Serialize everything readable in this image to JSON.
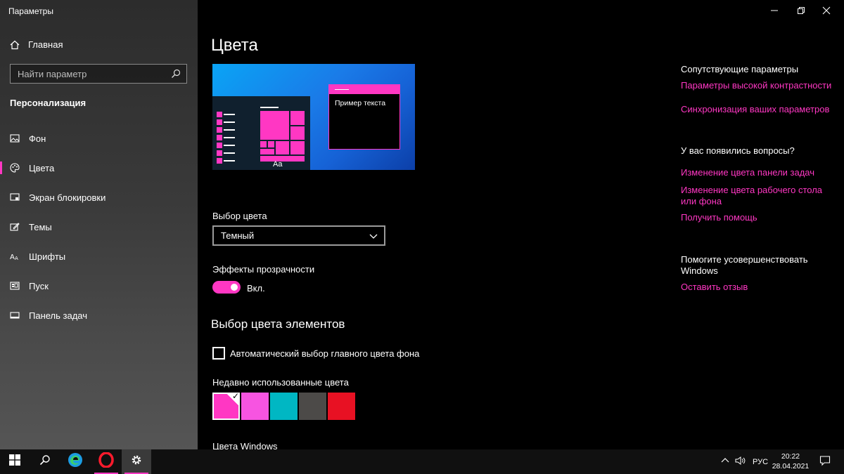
{
  "window": {
    "title": "Параметры"
  },
  "sidebar": {
    "home_label": "Главная",
    "search_placeholder": "Найти параметр",
    "section_title": "Персонализация",
    "items": [
      {
        "label": "Фон",
        "icon": "picture-icon"
      },
      {
        "label": "Цвета",
        "icon": "palette-icon",
        "active": true
      },
      {
        "label": "Экран блокировки",
        "icon": "lock-screen-icon"
      },
      {
        "label": "Темы",
        "icon": "themes-icon"
      },
      {
        "label": "Шрифты",
        "icon": "fonts-icon"
      },
      {
        "label": "Пуск",
        "icon": "start-icon"
      },
      {
        "label": "Панель задач",
        "icon": "taskbar-icon"
      }
    ]
  },
  "main": {
    "title": "Цвета",
    "preview": {
      "tile_text": "Aa",
      "window_text": "Пример текста"
    },
    "color_choice": {
      "label": "Выбор цвета",
      "selected": "Темный"
    },
    "transparency": {
      "label": "Эффекты прозрачности",
      "state_label": "Вкл.",
      "on": true
    },
    "accent_heading": "Выбор цвета элементов",
    "auto_accent_label": "Автоматический выбор главного цвета фона",
    "auto_accent_checked": false,
    "recent_colors_label": "Недавно использованные цвета",
    "recent_colors": [
      "#ff37c3",
      "#f754e1",
      "#00b7c3",
      "#4c4a48",
      "#e81123"
    ],
    "recent_selected_index": 0,
    "windows_colors_label": "Цвета Windows"
  },
  "aside": {
    "related_heading": "Сопутствующие параметры",
    "related_links": [
      "Параметры высокой контрастности",
      "Синхронизация ваших параметров"
    ],
    "questions_heading": "У вас появились вопросы?",
    "question_links": [
      "Изменение цвета панели задач",
      "Изменение цвета рабочего стола или фона",
      "Получить помощь"
    ],
    "improve_heading": "Помогите усовершенствовать Windows",
    "feedback_link": "Оставить отзыв"
  },
  "taskbar": {
    "apps": [
      "windows-start-icon",
      "search-icon",
      "edge-icon",
      "opera-icon",
      "settings-icon"
    ],
    "language": "РУС",
    "time": "20:22",
    "date": "28.04.2021"
  },
  "colors": {
    "accent": "#ff37c3",
    "background": "#000000"
  }
}
